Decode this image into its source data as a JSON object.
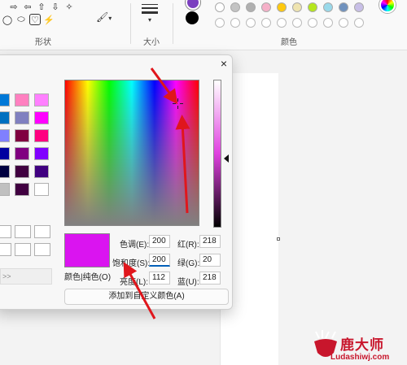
{
  "ribbon": {
    "shapes_label": "形状",
    "size_label": "大小",
    "colors_label": "颜色",
    "shapes": [
      {
        "icon": "right-arrow-icon",
        "glyph": "⇨"
      },
      {
        "icon": "left-arrow-icon",
        "glyph": "⇦"
      },
      {
        "icon": "up-arrow-icon",
        "glyph": "⇧"
      },
      {
        "icon": "down-arrow-icon",
        "glyph": "⇩"
      },
      {
        "icon": "star-icon",
        "glyph": "✧"
      },
      {
        "icon": "callout-icon",
        "glyph": "◯"
      },
      {
        "icon": "callout-oval-icon",
        "glyph": "⬭"
      },
      {
        "icon": "heart-icon",
        "glyph": "♡"
      },
      {
        "icon": "lightning-icon",
        "glyph": "⚡"
      }
    ],
    "color1": "#7b3fbf",
    "color2": "#000000",
    "palette_row1": [
      "#ffffff",
      "#c3c3c3",
      "#b0b0b0",
      "#f5b0c8",
      "#ffc90e",
      "#efe4b0",
      "#b5e61d",
      "#99d9ea",
      "#7092be",
      "#c8bfe7"
    ],
    "palette_row2": [
      "#ffffff",
      "#ffffff",
      "#ffffff",
      "#ffffff",
      "#ffffff",
      "#ffffff",
      "#ffffff",
      "#ffffff",
      "#ffffff",
      "#ffffff"
    ]
  },
  "dialog": {
    "close_glyph": "×",
    "basic_colors": [
      [
        "#0078d7",
        "#ff80c0",
        "#ff80ff"
      ],
      [
        "#0070c0",
        "#8080c0",
        "#ff00ff"
      ],
      [
        "#8080ff",
        "#800040",
        "#ff0080"
      ],
      [
        "#0000a0",
        "#800080",
        "#8000ff"
      ],
      [
        "#000040",
        "#400040",
        "#400080"
      ],
      [
        "#c0c0c0",
        "#400040",
        "#ffffff"
      ]
    ],
    "left_button_text": ">>",
    "solid_label": "颜色|纯色(O)",
    "fields_left": [
      {
        "label": "色调(E):",
        "value": "200"
      },
      {
        "label": "饱和度(S):",
        "value": "200"
      },
      {
        "label": "亮度(L):",
        "value": "112"
      }
    ],
    "fields_right": [
      {
        "label": "红(R):",
        "value": "218"
      },
      {
        "label": "绿(G):",
        "value": "20"
      },
      {
        "label": "蓝(U):",
        "value": "218"
      }
    ],
    "add_button": "添加到自定义颜色(A)",
    "preview_color": "#da14f0"
  },
  "watermark": {
    "title": "鹿大师",
    "url": "Ludashiwj.com"
  },
  "colors": {
    "arrow": "#e0161c",
    "watermark": "#c8162c"
  }
}
